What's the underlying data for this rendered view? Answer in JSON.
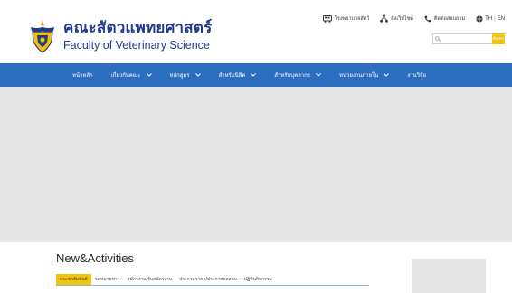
{
  "header": {
    "title_th": "คณะสัตวแพทยศาสตร์",
    "title_en": "Faculty of Veterinary Science",
    "top_links": [
      {
        "label": "โรงพยาบาลสัตว์",
        "icon": "hospital-bus-icon"
      },
      {
        "label": "ผังเว็บไซต์",
        "icon": "sitemap-icon"
      },
      {
        "label": "ติดต่อสอบถาม",
        "icon": "phone-icon"
      }
    ],
    "lang": {
      "th": "TH",
      "separator": "|",
      "en": "EN"
    },
    "search": {
      "placeholder": "",
      "button_label": "ค้นหา"
    }
  },
  "nav": {
    "items": [
      {
        "label": "หน้าหลัก",
        "has_dropdown": false
      },
      {
        "label": "เกี่ยวกับคณะ",
        "has_dropdown": true
      },
      {
        "label": "หลักสูตร",
        "has_dropdown": true
      },
      {
        "label": "สำหรับนิสิต",
        "has_dropdown": true
      },
      {
        "label": "สำหรับบุคลากร",
        "has_dropdown": true
      },
      {
        "label": "หน่วยงานภายใน",
        "has_dropdown": true
      },
      {
        "label": "งานวิจัย",
        "has_dropdown": false
      }
    ]
  },
  "news": {
    "title": "New&Activities",
    "tabs": [
      {
        "label": "ประชาสัมพันธ์",
        "active": true
      },
      {
        "label": "จดหมายข่าว",
        "active": false
      },
      {
        "label": "สมัครงาน/รับสมัครงาน",
        "active": false
      },
      {
        "label": "ประกวดราคา/ประกาศผลสอบ",
        "active": false
      },
      {
        "label": "ปฏิทินกิจกรรม",
        "active": false
      }
    ]
  },
  "colors": {
    "brand_blue": "#233a8a",
    "nav_blue": "#2b6ec0",
    "accent_yellow": "#f1c40f",
    "placeholder_gray": "#e6e6e6"
  }
}
